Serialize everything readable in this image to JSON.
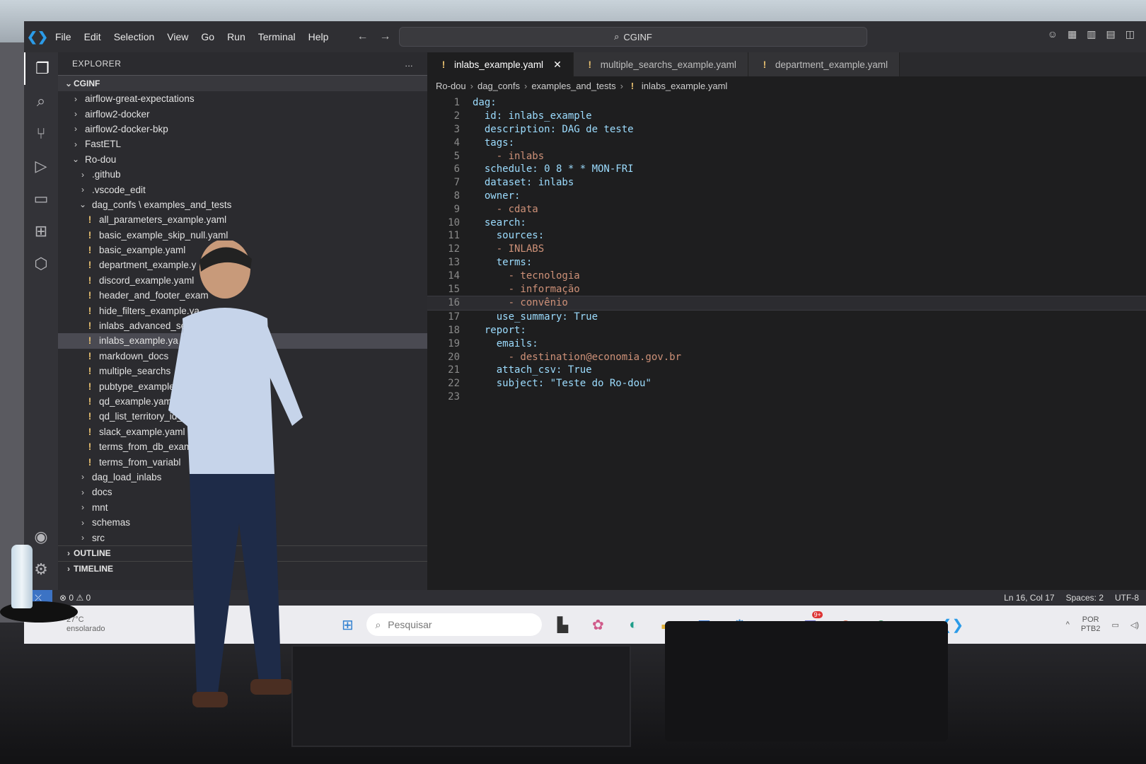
{
  "window": {
    "menu": [
      "File",
      "Edit",
      "Selection",
      "View",
      "Go",
      "Run",
      "Terminal",
      "Help"
    ],
    "command_center": "CGINF"
  },
  "sidebar": {
    "title": "EXPLORER",
    "more": "...",
    "root": "CGINF",
    "tree": [
      {
        "label": "airflow-great-expectations",
        "type": "folder",
        "depth": 0,
        "expanded": false
      },
      {
        "label": "airflow2-docker",
        "type": "folder",
        "depth": 0,
        "expanded": false
      },
      {
        "label": "airflow2-docker-bkp",
        "type": "folder",
        "depth": 0,
        "expanded": false
      },
      {
        "label": "FastETL",
        "type": "folder",
        "depth": 0,
        "expanded": false
      },
      {
        "label": "Ro-dou",
        "type": "folder",
        "depth": 0,
        "expanded": true
      },
      {
        "label": ".github",
        "type": "folder",
        "depth": 1,
        "expanded": false
      },
      {
        "label": ".vscode_edit",
        "type": "folder",
        "depth": 1,
        "expanded": false
      },
      {
        "label": "dag_confs \\ examples_and_tests",
        "type": "folder",
        "depth": 1,
        "expanded": true
      },
      {
        "label": "all_parameters_example.yaml",
        "type": "file",
        "depth": 2
      },
      {
        "label": "basic_example_skip_null.yaml",
        "type": "file",
        "depth": 2
      },
      {
        "label": "basic_example.yaml",
        "type": "file",
        "depth": 2
      },
      {
        "label": "department_example.y",
        "type": "file",
        "depth": 2
      },
      {
        "label": "discord_example.yaml",
        "type": "file",
        "depth": 2
      },
      {
        "label": "header_and_footer_exam",
        "type": "file",
        "depth": 2
      },
      {
        "label": "hide_filters_example.ya",
        "type": "file",
        "depth": 2
      },
      {
        "label": "inlabs_advanced_se                    aml",
        "type": "file",
        "depth": 2
      },
      {
        "label": "inlabs_example.ya",
        "type": "file",
        "depth": 2,
        "selected": true
      },
      {
        "label": "markdown_docs",
        "type": "file",
        "depth": 2
      },
      {
        "label": "multiple_searchs",
        "type": "file",
        "depth": 2
      },
      {
        "label": "pubtype_example",
        "type": "file",
        "depth": 2
      },
      {
        "label": "qd_example.yaml",
        "type": "file",
        "depth": 2
      },
      {
        "label": "qd_list_territory_id_e",
        "type": "file",
        "depth": 2
      },
      {
        "label": "slack_example.yaml",
        "type": "file",
        "depth": 2
      },
      {
        "label": "terms_from_db_exam",
        "type": "file",
        "depth": 2
      },
      {
        "label": "terms_from_variabl",
        "type": "file",
        "depth": 2
      },
      {
        "label": "dag_load_inlabs",
        "type": "folder",
        "depth": 1,
        "expanded": false
      },
      {
        "label": "docs",
        "type": "folder",
        "depth": 1,
        "expanded": false
      },
      {
        "label": "mnt",
        "type": "folder",
        "depth": 1,
        "expanded": false
      },
      {
        "label": "schemas",
        "type": "folder",
        "depth": 1,
        "expanded": false
      },
      {
        "label": "src",
        "type": "folder",
        "depth": 1,
        "expanded": false
      }
    ],
    "sections": [
      "OUTLINE",
      "TIMELINE"
    ]
  },
  "tabs": [
    {
      "label": "inlabs_example.yaml",
      "active": true
    },
    {
      "label": "multiple_searchs_example.yaml",
      "active": false
    },
    {
      "label": "department_example.yaml",
      "active": false
    }
  ],
  "breadcrumb": [
    "Ro-dou",
    "dag_confs",
    "examples_and_tests",
    "inlabs_example.yaml"
  ],
  "editor": {
    "current_line": 16,
    "lines": [
      {
        "n": "1",
        "text": "dag:"
      },
      {
        "n": "2",
        "text": "  id: inlabs_example"
      },
      {
        "n": "3",
        "text": "  description: DAG de teste"
      },
      {
        "n": "4",
        "text": "  tags:"
      },
      {
        "n": "5",
        "text": "    - inlabs"
      },
      {
        "n": "6",
        "text": "  schedule: 0 8 * * MON-FRI"
      },
      {
        "n": "7",
        "text": "  dataset: inlabs"
      },
      {
        "n": "8",
        "text": "  owner:"
      },
      {
        "n": "9",
        "text": "    - cdata"
      },
      {
        "n": "10",
        "text": "  search:"
      },
      {
        "n": "11",
        "text": "    sources:"
      },
      {
        "n": "12",
        "text": "    - INLABS"
      },
      {
        "n": "13",
        "text": "    terms:"
      },
      {
        "n": "14",
        "text": "      - tecnologia"
      },
      {
        "n": "15",
        "text": "      - informação"
      },
      {
        "n": "16",
        "text": "      - convênio"
      },
      {
        "n": "17",
        "text": "    use_summary: True"
      },
      {
        "n": "18",
        "text": "  report:"
      },
      {
        "n": "19",
        "text": "    emails:"
      },
      {
        "n": "20",
        "text": "      - destination@economia.gov.br"
      },
      {
        "n": "21",
        "text": "    attach_csv: True"
      },
      {
        "n": "22",
        "text": "    subject: \"Teste do Ro-dou\""
      },
      {
        "n": "23",
        "text": ""
      }
    ]
  },
  "statusbar": {
    "errors": "0",
    "warnings": "0",
    "position": "Ln 16, Col 17",
    "spaces": "Spaces: 2",
    "encoding": "UTF-8"
  },
  "taskbar": {
    "weather_temp": "27°C",
    "weather_desc": "ensolarado",
    "search_placeholder": "Pesquisar",
    "badge": "9+",
    "lang_1": "POR",
    "lang_2": "PTB2"
  },
  "colors": {
    "accent": "#2b9be8",
    "yaml_warning": "#e8c070",
    "key": "#9cdcfe",
    "string": "#ce9178",
    "bool": "#569cd6"
  }
}
